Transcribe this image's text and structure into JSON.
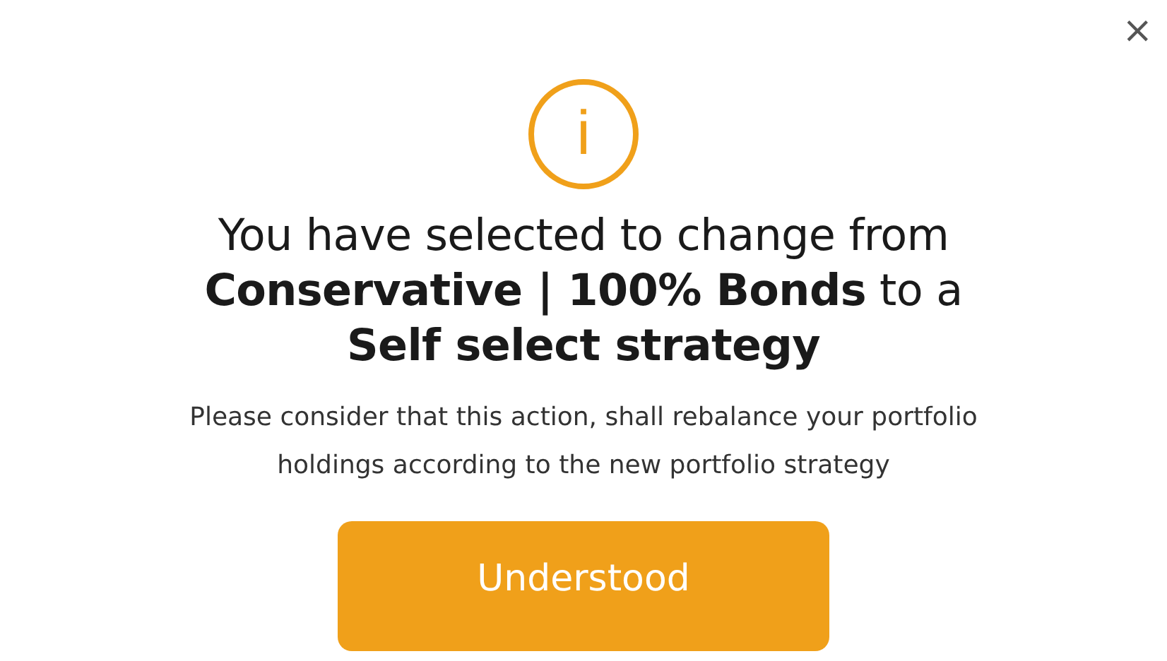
{
  "dialog": {
    "close": "×",
    "icon": "i",
    "heading": "You have selected to change from\n**Conservative | 100% Bonds** to a\n**Self select strategy**",
    "message": "Please consider that this action, shall rebalance your portfolio\nholdings according to the new portfolio strategy",
    "button": "Understood"
  }
}
